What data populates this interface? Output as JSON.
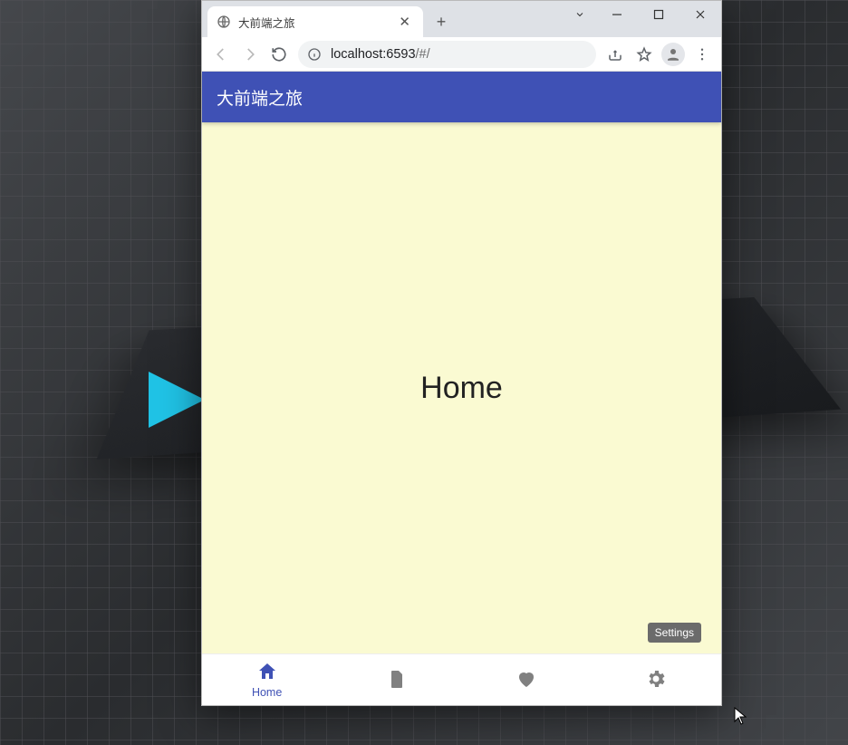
{
  "browser": {
    "tab_title": "大前端之旅",
    "url_host": "localhost:",
    "url_port": "6593",
    "url_path": "/#/"
  },
  "app": {
    "header_title": "大前端之旅",
    "body_label": "Home",
    "tooltip": "Settings",
    "nav": {
      "home": "Home"
    }
  },
  "colors": {
    "primary": "#3f51b5",
    "body_bg": "#fafad2"
  }
}
